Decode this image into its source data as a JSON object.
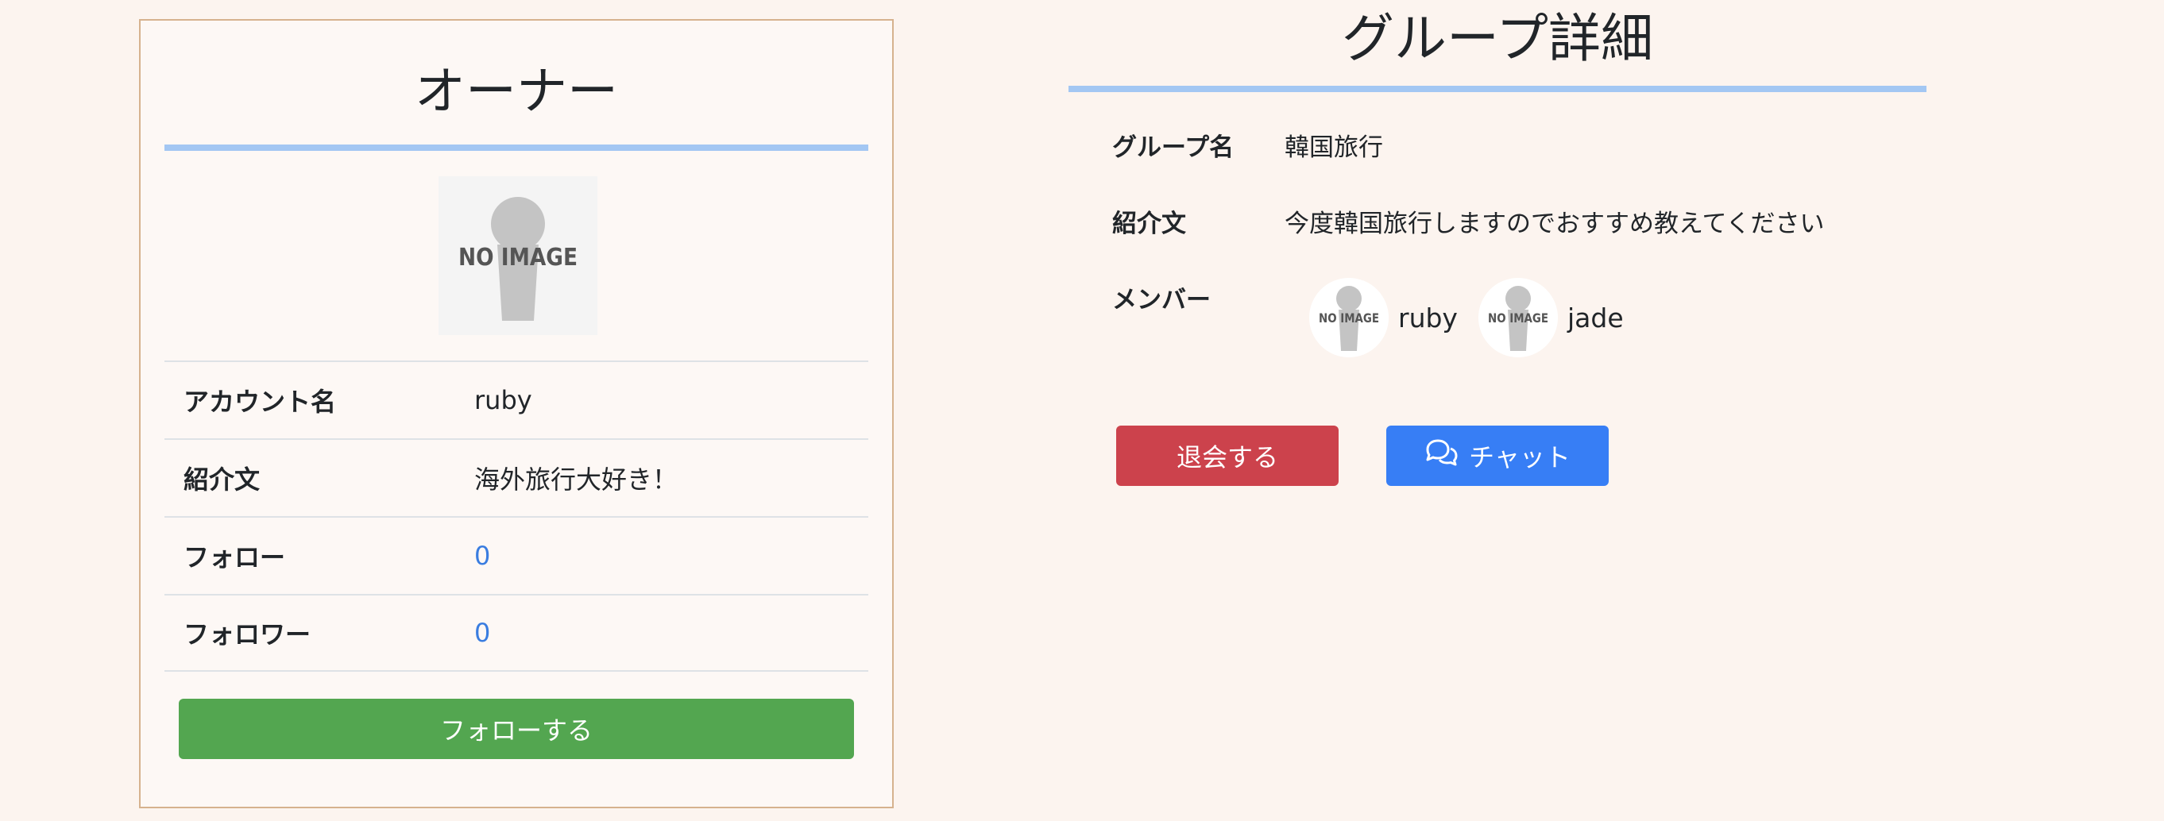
{
  "owner": {
    "title": "オーナー",
    "avatar_text": "NO IMAGE",
    "rows": [
      {
        "label": "アカウント名",
        "value": "ruby"
      },
      {
        "label": "紹介文",
        "value": "海外旅行大好き！"
      },
      {
        "label": "フォロー",
        "value": "0"
      },
      {
        "label": "フォロワー",
        "value": "0"
      }
    ],
    "follow_button": "フォローする"
  },
  "group": {
    "title": "グループ詳細",
    "name_label": "グループ名",
    "name_value": "韓国旅行",
    "intro_label": "紹介文",
    "intro_value": "今度韓国旅行しますのでおすすめ教えてください",
    "members_label": "メンバー",
    "members": [
      {
        "name": "ruby",
        "avatar_text": "NO IMAGE"
      },
      {
        "name": "jade",
        "avatar_text": "NO IMAGE"
      }
    ],
    "leave_button": "退会する",
    "chat_button": "チャット",
    "chat_icon": "chat-bubbles-icon"
  },
  "colors": {
    "page_bg": "#fcf4ef",
    "accent_rule": "#a3c7f3",
    "follow": "#53a650",
    "leave": "#cc424c",
    "chat": "#377ef5",
    "link": "#3a7de0"
  }
}
